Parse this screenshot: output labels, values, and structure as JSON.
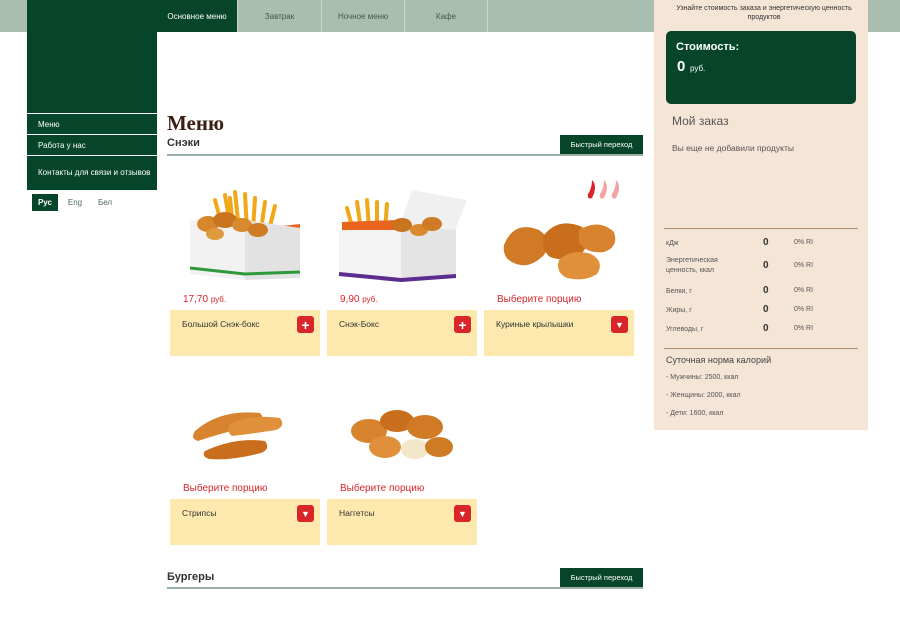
{
  "nav": {
    "tabs": [
      {
        "label": "Основное меню",
        "active": true
      },
      {
        "label": "Завтрак",
        "active": false
      },
      {
        "label": "Ночное меню",
        "active": false
      },
      {
        "label": "Кафе",
        "active": false
      }
    ]
  },
  "sidebar": {
    "items": [
      "Меню",
      "Работа у нас",
      "Контакты для связи и отзывов"
    ],
    "languages": [
      "Рус",
      "Eng",
      "Бел"
    ]
  },
  "main": {
    "title": "Меню",
    "quick_jump_label": "Быстрый переход",
    "sections": [
      {
        "title": "Снэки",
        "items": [
          {
            "name": "Большой Снэк-бокс",
            "price": "17,70",
            "currency": "руб.",
            "action_icon": "plus-icon",
            "image_icon": "snack-box-large-image"
          },
          {
            "name": "Снэк-Бокс",
            "price": "9,90",
            "currency": "руб.",
            "action_icon": "plus-icon",
            "image_icon": "snack-box-image"
          },
          {
            "name": "Куриные крылышки",
            "price_label": "Выберите порцию",
            "action_icon": "chevron-down-icon",
            "image_icon": "chicken-wings-image",
            "spicy": true
          },
          {
            "name": "Стрипсы",
            "price_label": "Выберите порцию",
            "action_icon": "chevron-down-icon",
            "image_icon": "chicken-strips-image"
          },
          {
            "name": "Наггетсы",
            "price_label": "Выберите порцию",
            "action_icon": "chevron-down-icon",
            "image_icon": "nuggets-image"
          }
        ]
      },
      {
        "title": "Бургеры",
        "items": []
      }
    ]
  },
  "order_panel": {
    "hint": "Узнайте стоимость заказа и энергетическую ценность продуктов",
    "cost_label": "Стоимость:",
    "cost_value": "0",
    "cost_currency": "руб.",
    "my_order_title": "Мой заказ",
    "empty_text": "Вы еще не добавили продукты",
    "nutrition": [
      {
        "label": "кДж",
        "value": "0",
        "percent": "0% RI"
      },
      {
        "label": "Энергетическая ценность, ккал",
        "value": "0",
        "percent": "0% RI"
      },
      {
        "label": "Белки, г",
        "value": "0",
        "percent": "0% RI"
      },
      {
        "label": "Жиры, г",
        "value": "0",
        "percent": "0% RI"
      },
      {
        "label": "Углеводы, г",
        "value": "0",
        "percent": "0% RI"
      }
    ],
    "daily_title": "Суточная норма калорий",
    "daily": [
      "- Мужчины: 2500, ккал",
      "- Женщины: 2000, ккал",
      "- Дети: 1600, ккал"
    ]
  },
  "colors": {
    "brand_green": "#06452a",
    "price_red": "#d9262a",
    "card_bg": "#fde8ae",
    "panel_bg": "#f5e5d6",
    "topbar_bg": "#a9bdb1"
  }
}
